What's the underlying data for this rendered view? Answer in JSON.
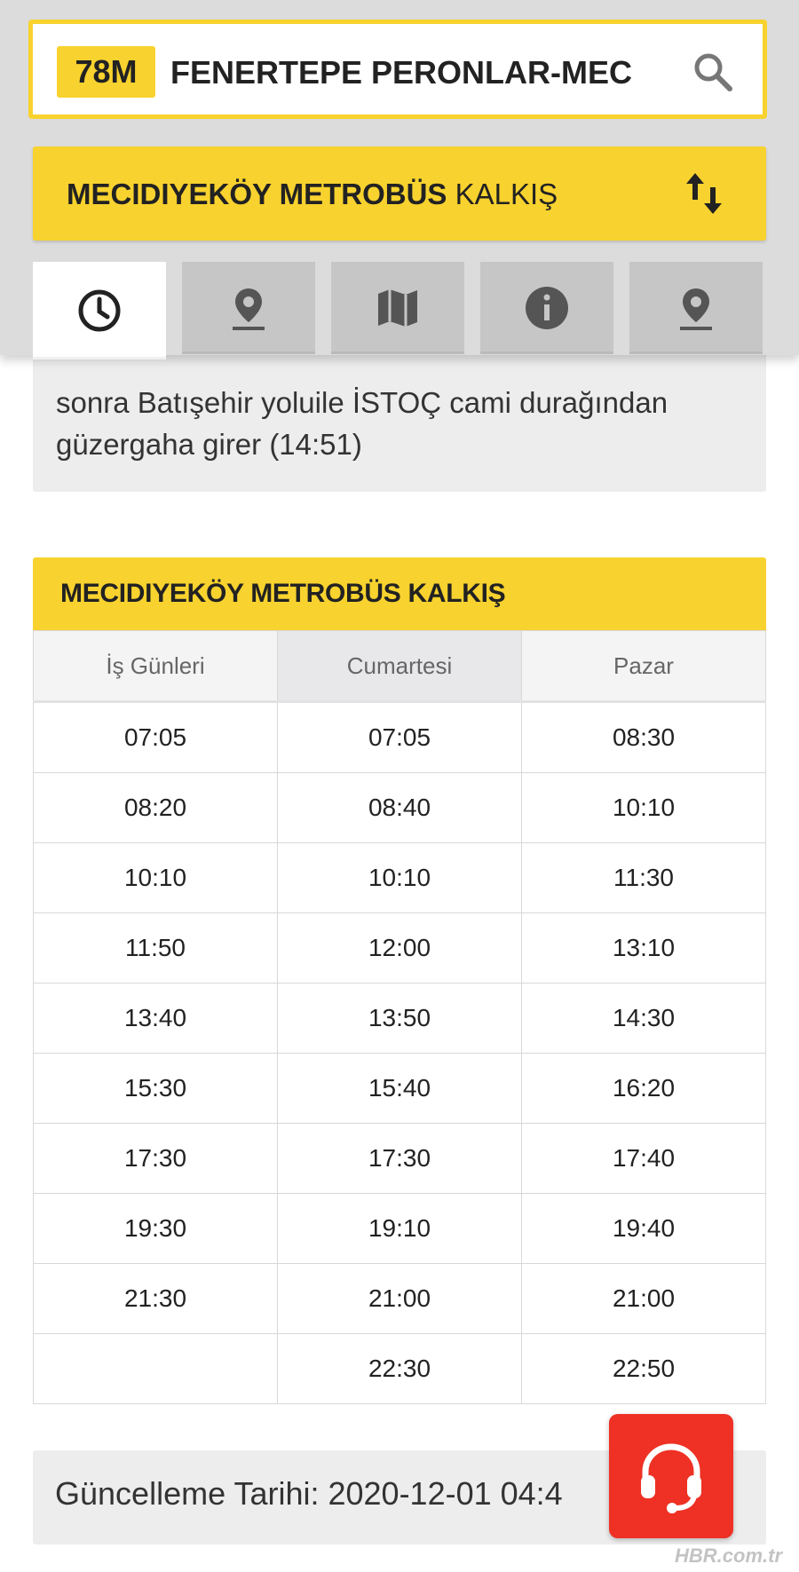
{
  "header": {
    "route_code": "78M",
    "route_name": "FENERTEPE PERONLAR-MECİ...",
    "direction_bold": "MECIDIYEKÖY METROBÜS",
    "direction_light": "KALKIŞ"
  },
  "tabs": [
    {
      "name": "tab-schedule",
      "icon": "clock-icon",
      "active": true
    },
    {
      "name": "tab-stops",
      "icon": "location-pin-icon",
      "active": false
    },
    {
      "name": "tab-map",
      "icon": "map-icon",
      "active": false
    },
    {
      "name": "tab-info",
      "icon": "info-icon",
      "active": false
    },
    {
      "name": "tab-nearby",
      "icon": "location-pin-icon",
      "active": false
    }
  ],
  "description": {
    "line1": "sonra Batışehir yoluile İSTOÇ cami durağından",
    "line2": "güzergaha girer (14:51)"
  },
  "schedule": {
    "title": "MECIDIYEKÖY METROBÜS KALKIŞ",
    "columns": [
      "İş Günleri",
      "Cumartesi",
      "Pazar"
    ],
    "rows": [
      [
        "07:05",
        "07:05",
        "08:30"
      ],
      [
        "08:20",
        "08:40",
        "10:10"
      ],
      [
        "10:10",
        "10:10",
        "11:30"
      ],
      [
        "11:50",
        "12:00",
        "13:10"
      ],
      [
        "13:40",
        "13:50",
        "14:30"
      ],
      [
        "15:30",
        "15:40",
        "16:20"
      ],
      [
        "17:30",
        "17:30",
        "17:40"
      ],
      [
        "19:30",
        "19:10",
        "19:40"
      ],
      [
        "21:30",
        "21:00",
        "21:00"
      ],
      [
        "",
        "22:30",
        "22:50"
      ]
    ]
  },
  "update": {
    "text": "Güncelleme Tarihi: 2020-12-01 04:4"
  },
  "watermark": "HBR.com.tr",
  "colors": {
    "accent": "#f8d22e",
    "support_button": "#ee3124"
  }
}
